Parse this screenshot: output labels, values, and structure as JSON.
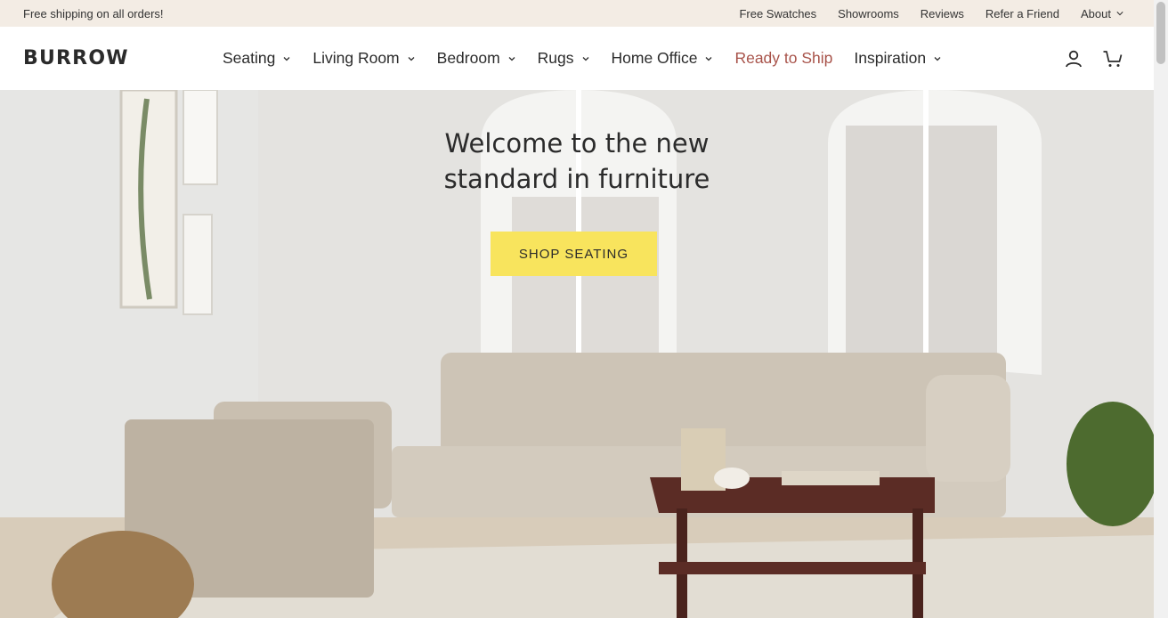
{
  "announcement": {
    "text": "Free shipping on all orders!",
    "links": [
      "Free Swatches",
      "Showrooms",
      "Reviews",
      "Refer a Friend",
      "About"
    ]
  },
  "header": {
    "logo": "BURROW",
    "nav": [
      {
        "label": "Seating",
        "has_dropdown": true
      },
      {
        "label": "Living Room",
        "has_dropdown": true
      },
      {
        "label": "Bedroom",
        "has_dropdown": true
      },
      {
        "label": "Rugs",
        "has_dropdown": true
      },
      {
        "label": "Home Office",
        "has_dropdown": true
      },
      {
        "label": "Ready to Ship",
        "has_dropdown": false
      },
      {
        "label": "Inspiration",
        "has_dropdown": true
      }
    ],
    "icons": [
      "account-icon",
      "cart-icon"
    ]
  },
  "hero": {
    "title": "Welcome to the new standard in furniture",
    "cta_label": "SHOP SEATING"
  },
  "colors": {
    "topbar_bg": "#f3ece4",
    "cta_bg": "#f8e45d",
    "highlight_nav": "#a8534a",
    "text": "#2b2b2b"
  }
}
